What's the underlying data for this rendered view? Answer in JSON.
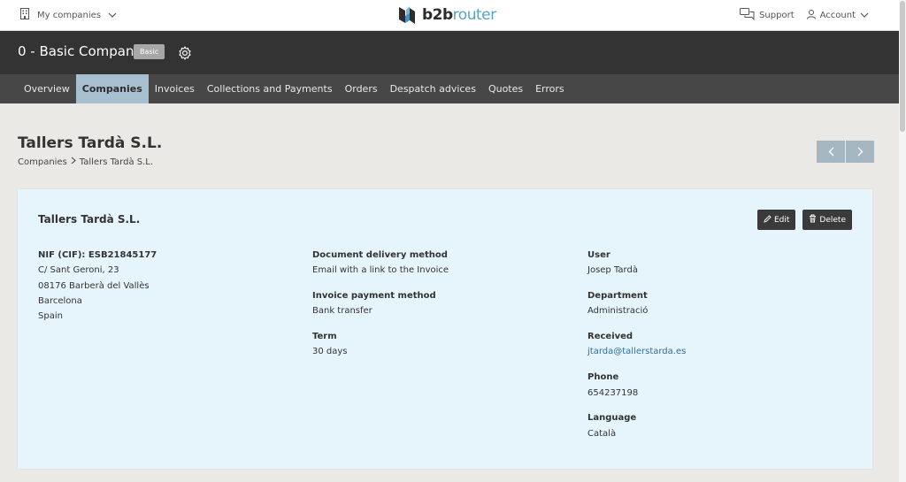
{
  "topbar": {
    "companies_label": "My companies",
    "support_label": "Support",
    "account_label": "Account",
    "logo_b2b": "b2b",
    "logo_router": "router"
  },
  "company": {
    "name": "0 - Basic Company",
    "plan_badge": "Basic"
  },
  "nav": {
    "items": [
      "Overview",
      "Companies",
      "Invoices",
      "Collections and Payments",
      "Orders",
      "Despatch advices",
      "Quotes",
      "Errors"
    ],
    "active": "Companies"
  },
  "page": {
    "title": "Tallers Tardà S.L.",
    "breadcrumb": [
      "Companies",
      "Tallers Tardà S.L."
    ]
  },
  "card": {
    "title": "Tallers Tardà S.L.",
    "edit_label": "Edit",
    "delete_label": "Delete",
    "address": {
      "nif": "NIF (CIF): ESB21845177",
      "street": "C/ Sant Geroni, 23",
      "city": "08176 Barberà del Vallès",
      "province": "Barcelona",
      "country": "Spain"
    },
    "delivery": {
      "label": "Document delivery method",
      "value": "Email with a link to the Invoice"
    },
    "payment": {
      "label": "Invoice payment method",
      "value": "Bank transfer"
    },
    "term": {
      "label": "Term",
      "value": "30 days"
    },
    "user": {
      "label": "User",
      "value": "Josep Tardà"
    },
    "department": {
      "label": "Department",
      "value": "Administració"
    },
    "received": {
      "label": "Received",
      "value": "jtarda@tallerstarda.es"
    },
    "phone": {
      "label": "Phone",
      "value": "654237198"
    },
    "language": {
      "label": "Language",
      "value": "Català"
    }
  },
  "colors": {
    "accent": "#a8bfd0",
    "dark_bar": "#333333",
    "nav_bar": "#474747",
    "card_bg": "#e6f4fb",
    "link": "#2f6f9a"
  },
  "icons": [
    "building-icon",
    "chevron-down-icon",
    "chat-icon",
    "user-icon",
    "gear-icon",
    "chevron-left-icon",
    "chevron-right-icon",
    "pencil-icon",
    "trash-icon"
  ]
}
